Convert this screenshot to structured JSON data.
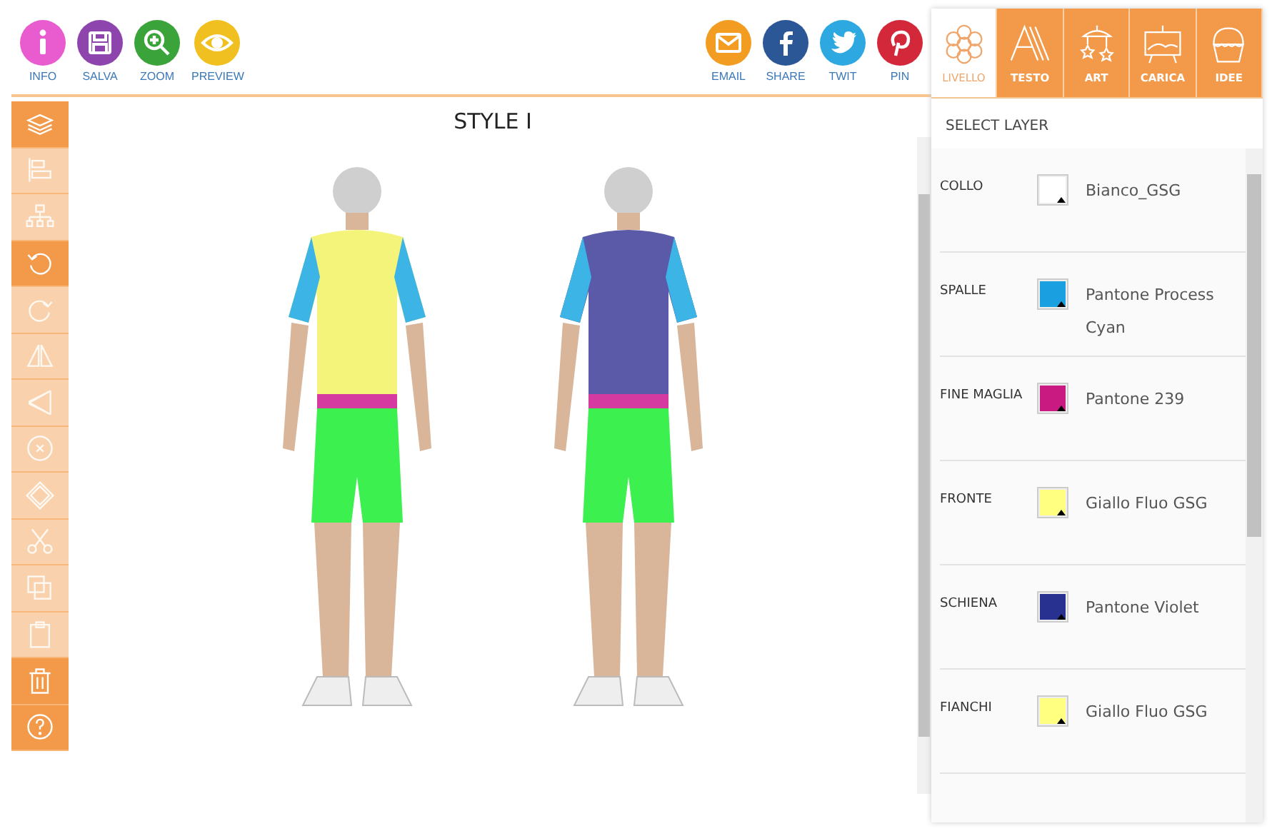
{
  "toolbar_left": [
    {
      "label": "INFO",
      "kind": "info",
      "color": "#e95ccf"
    },
    {
      "label": "SALVA",
      "kind": "save",
      "color": "#8e44ad"
    },
    {
      "label": "ZOOM",
      "kind": "zoom",
      "color": "#3aa33a"
    },
    {
      "label": "PREVIEW",
      "kind": "preview",
      "color": "#f0c020"
    }
  ],
  "toolbar_right": [
    {
      "label": "EMAIL",
      "kind": "email",
      "color": "#f39c22"
    },
    {
      "label": "SHARE",
      "kind": "facebook",
      "color": "#2b5797"
    },
    {
      "label": "TWIT",
      "kind": "twitter",
      "color": "#2ea8e0"
    },
    {
      "label": "PIN",
      "kind": "pinterest",
      "color": "#d3283a"
    }
  ],
  "tabs": [
    {
      "label": "LIVELLO",
      "kind": "flower",
      "selected": true
    },
    {
      "label": "TESTO",
      "kind": "text",
      "selected": false
    },
    {
      "label": "ART",
      "kind": "stars",
      "selected": false
    },
    {
      "label": "CARICA",
      "kind": "picture",
      "selected": false
    },
    {
      "label": "IDEE",
      "kind": "cupcake",
      "selected": false
    }
  ],
  "tools": [
    {
      "kind": "layers",
      "disabled": false
    },
    {
      "kind": "align",
      "disabled": true
    },
    {
      "kind": "tree",
      "disabled": true
    },
    {
      "kind": "undo",
      "disabled": false
    },
    {
      "kind": "redo",
      "disabled": true
    },
    {
      "kind": "flip-h",
      "disabled": true
    },
    {
      "kind": "flip-v",
      "disabled": true
    },
    {
      "kind": "remove",
      "disabled": true
    },
    {
      "kind": "diamond",
      "disabled": true
    },
    {
      "kind": "cut",
      "disabled": true
    },
    {
      "kind": "copy",
      "disabled": true
    },
    {
      "kind": "paste",
      "disabled": true
    },
    {
      "kind": "delete",
      "disabled": false
    },
    {
      "kind": "help",
      "disabled": false
    }
  ],
  "canvas": {
    "title": "STYLE I"
  },
  "panel": {
    "heading": "SELECT LAYER",
    "layers": [
      {
        "name": "COLLO",
        "color": "#ffffff",
        "value": "Bianco_GSG"
      },
      {
        "name": "SPALLE",
        "color": "#1aa0e0",
        "value": "Pantone Process Cyan"
      },
      {
        "name": "FINE MAGLIA",
        "color": "#c81a80",
        "value": "Pantone 239"
      },
      {
        "name": "FRONTE",
        "color": "#ffff80",
        "value": "Giallo Fluo GSG"
      },
      {
        "name": "SCHIENA",
        "color": "#283090",
        "value": "Pantone Violet"
      },
      {
        "name": "FIANCHI",
        "color": "#ffff80",
        "value": "Giallo Fluo GSG"
      }
    ]
  }
}
